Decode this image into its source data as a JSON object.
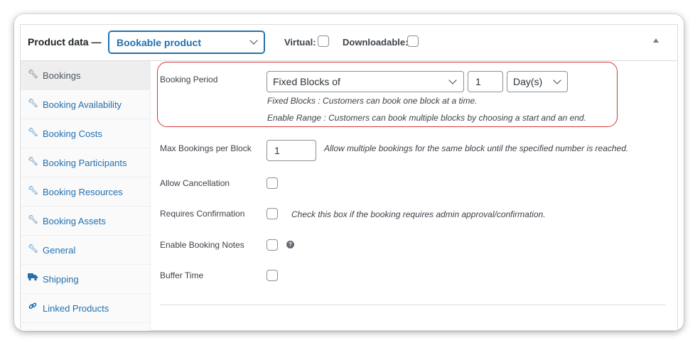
{
  "header": {
    "title": "Product data —",
    "product_type": "Bookable product",
    "virtual_label": "Virtual:",
    "downloadable_label": "Downloadable:"
  },
  "sidebar": {
    "items": [
      {
        "label": "Bookings",
        "icon": "wrench-icon"
      },
      {
        "label": "Booking Availability",
        "icon": "wrench-icon"
      },
      {
        "label": "Booking Costs",
        "icon": "wrench-icon"
      },
      {
        "label": "Booking Participants",
        "icon": "wrench-icon"
      },
      {
        "label": "Booking Resources",
        "icon": "wrench-icon"
      },
      {
        "label": "Booking Assets",
        "icon": "wrench-icon"
      },
      {
        "label": "General",
        "icon": "wrench-icon"
      },
      {
        "label": "Shipping",
        "icon": "truck-icon"
      },
      {
        "label": "Linked Products",
        "icon": "link-icon"
      }
    ]
  },
  "booking_period": {
    "label": "Booking Period",
    "type": "Fixed Blocks of",
    "count": "1",
    "unit": "Day(s)",
    "desc_fixed": "Fixed Blocks : Customers can book one block at a time.",
    "desc_range": "Enable Range : Customers can book multiple blocks by choosing a start and an end."
  },
  "max_bookings": {
    "label": "Max Bookings per Block",
    "value": "1",
    "desc": "Allow multiple bookings for the same block until the specified number is reached."
  },
  "allow_cancellation": {
    "label": "Allow Cancellation"
  },
  "requires_confirmation": {
    "label": "Requires Confirmation",
    "desc": "Check this box if the booking requires admin approval/confirmation."
  },
  "booking_notes": {
    "label": "Enable Booking Notes",
    "help": "?"
  },
  "buffer_time": {
    "label": "Buffer Time"
  },
  "colors": {
    "accent": "#2271b1",
    "highlight": "#d63638"
  }
}
